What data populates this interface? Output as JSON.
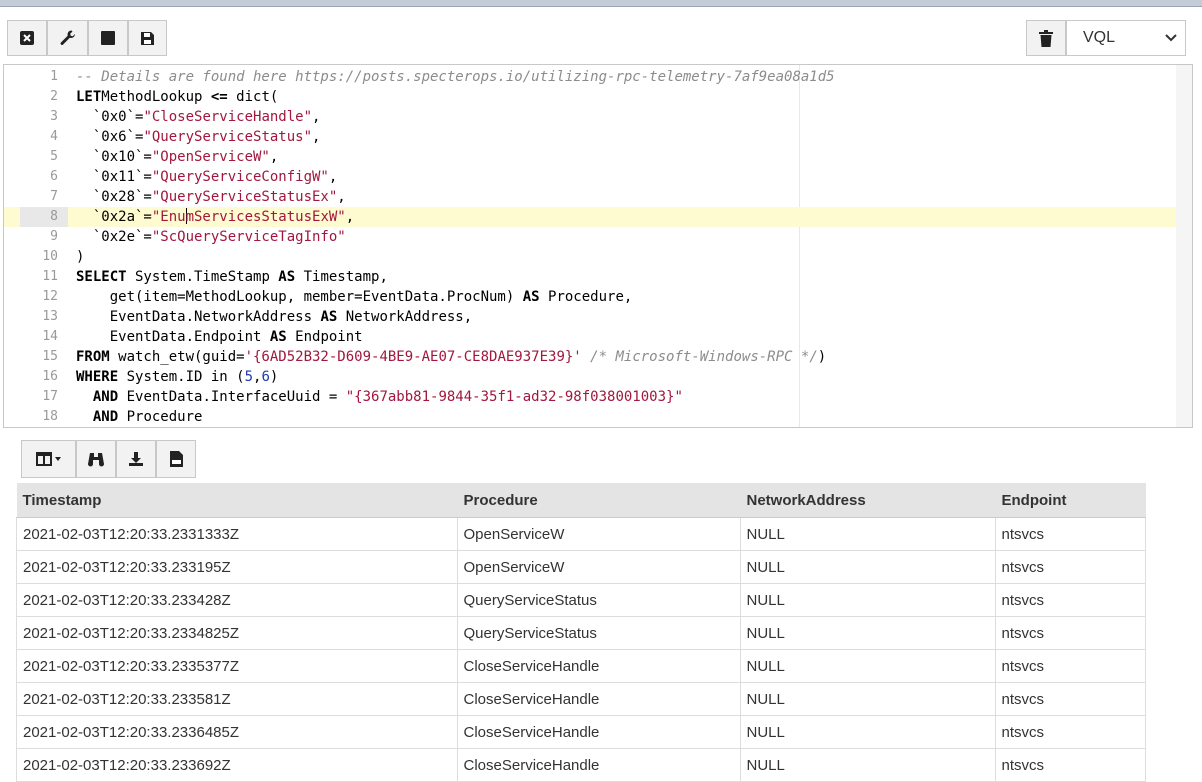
{
  "toolbar": {
    "select_value": "VQL"
  },
  "editor": {
    "lines": [
      {
        "n": "1",
        "parts": [
          [
            "cm",
            "-- Details are found here https://posts.specterops.io/utilizing-rpc-telemetry-7af9ea08a1d5"
          ]
        ]
      },
      {
        "n": "2",
        "parts": [
          [
            "kw",
            "LET"
          ],
          [
            "",
            "MethodLookup "
          ],
          [
            "kw",
            "<="
          ],
          [
            "",
            " dict("
          ]
        ]
      },
      {
        "n": "3",
        "parts": [
          [
            "",
            "  `0x0`="
          ],
          [
            "str",
            "\"CloseServiceHandle\""
          ],
          [
            "",
            ","
          ]
        ]
      },
      {
        "n": "4",
        "parts": [
          [
            "",
            "  `0x6`="
          ],
          [
            "str",
            "\"QueryServiceStatus\""
          ],
          [
            "",
            ","
          ]
        ]
      },
      {
        "n": "5",
        "parts": [
          [
            "",
            "  `0x10`="
          ],
          [
            "str",
            "\"OpenServiceW\""
          ],
          [
            "",
            ","
          ]
        ]
      },
      {
        "n": "6",
        "parts": [
          [
            "",
            "  `0x11`="
          ],
          [
            "str",
            "\"QueryServiceConfigW\""
          ],
          [
            "",
            ","
          ]
        ]
      },
      {
        "n": "7",
        "parts": [
          [
            "",
            "  `0x28`="
          ],
          [
            "str",
            "\"QueryServiceStatusEx\""
          ],
          [
            "",
            ","
          ]
        ]
      },
      {
        "n": "8",
        "parts": [
          [
            "",
            "  `0x2a`="
          ],
          [
            "str",
            "\"Enu"
          ],
          [
            "cur",
            ""
          ],
          [
            "str",
            "mServicesStatusExW\""
          ],
          [
            "",
            ","
          ]
        ]
      },
      {
        "n": "9",
        "parts": [
          [
            "",
            "  `0x2e`="
          ],
          [
            "str",
            "\"ScQueryServiceTagInfo\""
          ]
        ]
      },
      {
        "n": "10",
        "parts": [
          [
            "",
            ")"
          ]
        ]
      },
      {
        "n": "11",
        "parts": [
          [
            "kw",
            "SELECT"
          ],
          [
            "",
            " System.TimeStamp "
          ],
          [
            "kw",
            "AS"
          ],
          [
            "",
            " Timestamp,"
          ]
        ]
      },
      {
        "n": "12",
        "parts": [
          [
            "",
            "    get(item=MethodLookup, member=EventData.ProcNum) "
          ],
          [
            "kw",
            "AS"
          ],
          [
            "",
            " Procedure,"
          ]
        ]
      },
      {
        "n": "13",
        "parts": [
          [
            "",
            "    EventData.NetworkAddress "
          ],
          [
            "kw",
            "AS"
          ],
          [
            "",
            " NetworkAddress,"
          ]
        ]
      },
      {
        "n": "14",
        "parts": [
          [
            "",
            "    EventData.Endpoint "
          ],
          [
            "kw",
            "AS"
          ],
          [
            "",
            " Endpoint"
          ]
        ]
      },
      {
        "n": "15",
        "parts": [
          [
            "kw",
            "FROM"
          ],
          [
            "",
            " watch_etw(guid="
          ],
          [
            "str",
            "'{6AD52B32-D609-4BE9-AE07-CE8DAE937E39}'"
          ],
          [
            "",
            " "
          ],
          [
            "cm",
            "/* Microsoft-Windows-RPC */"
          ],
          [
            "",
            ")"
          ]
        ]
      },
      {
        "n": "16",
        "parts": [
          [
            "kw",
            "WHERE"
          ],
          [
            "",
            " System.ID in ("
          ],
          [
            "num",
            "5"
          ],
          [
            "",
            ","
          ],
          [
            "num",
            "6"
          ],
          [
            "",
            ")"
          ]
        ]
      },
      {
        "n": "17",
        "parts": [
          [
            "",
            "  "
          ],
          [
            "kw",
            "AND"
          ],
          [
            "",
            " EventData.InterfaceUuid = "
          ],
          [
            "str",
            "\"{367abb81-9844-35f1-ad32-98f038001003}\""
          ]
        ]
      },
      {
        "n": "18",
        "parts": [
          [
            "",
            "  "
          ],
          [
            "kw",
            "AND"
          ],
          [
            "",
            " Procedure"
          ]
        ]
      }
    ]
  },
  "table": {
    "headers": [
      "Timestamp",
      "Procedure",
      "NetworkAddress",
      "Endpoint"
    ],
    "rows": [
      [
        "2021-02-03T12:20:33.2331333Z",
        "OpenServiceW",
        "NULL",
        "ntsvcs"
      ],
      [
        "2021-02-03T12:20:33.233195Z",
        "OpenServiceW",
        "NULL",
        "ntsvcs"
      ],
      [
        "2021-02-03T12:20:33.233428Z",
        "QueryServiceStatus",
        "NULL",
        "ntsvcs"
      ],
      [
        "2021-02-03T12:20:33.2334825Z",
        "QueryServiceStatus",
        "NULL",
        "ntsvcs"
      ],
      [
        "2021-02-03T12:20:33.2335377Z",
        "CloseServiceHandle",
        "NULL",
        "ntsvcs"
      ],
      [
        "2021-02-03T12:20:33.233581Z",
        "CloseServiceHandle",
        "NULL",
        "ntsvcs"
      ],
      [
        "2021-02-03T12:20:33.2336485Z",
        "CloseServiceHandle",
        "NULL",
        "ntsvcs"
      ],
      [
        "2021-02-03T12:20:33.233692Z",
        "CloseServiceHandle",
        "NULL",
        "ntsvcs"
      ]
    ]
  }
}
